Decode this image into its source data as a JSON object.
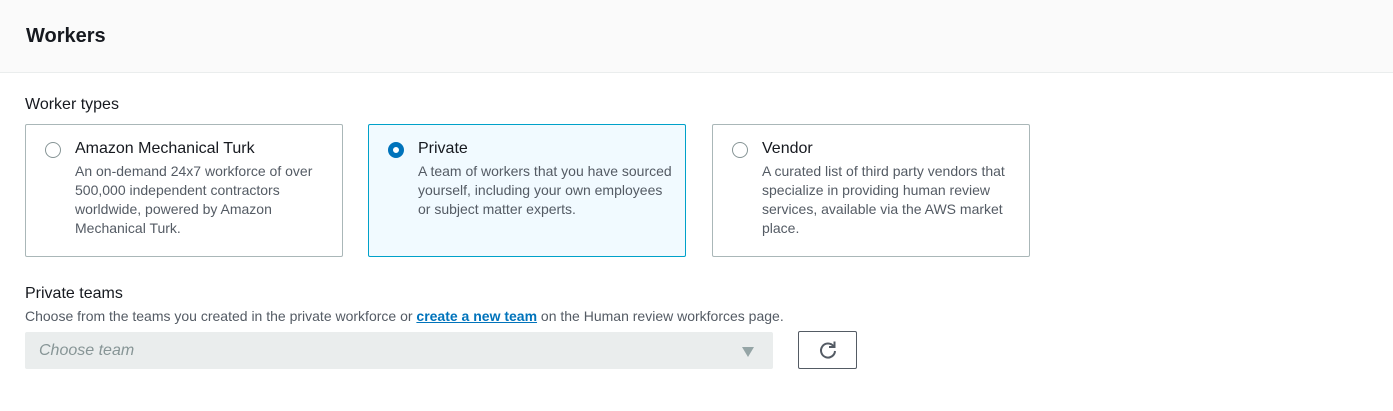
{
  "header": {
    "title": "Workers"
  },
  "worker_types": {
    "label": "Worker types",
    "options": [
      {
        "title": "Amazon Mechanical Turk",
        "description": "An on-demand 24x7 workforce of over 500,000 independent contractors worldwide, powered by Amazon Mechanical Turk.",
        "selected": false
      },
      {
        "title": "Private",
        "description": "A team of workers that you have sourced yourself, including your own employees or subject matter experts.",
        "selected": true
      },
      {
        "title": "Vendor",
        "description": "A curated list of third party vendors that specialize in providing human review services, available via the AWS market place.",
        "selected": false
      }
    ]
  },
  "private_teams": {
    "label": "Private teams",
    "description_before": "Choose from the teams you created in the private workforce or ",
    "link_text": "create a new team",
    "description_after": " on the Human review workforces page.",
    "select_placeholder": "Choose team",
    "refresh_icon": "refresh-icon"
  },
  "colors": {
    "accent": "#0073bb",
    "selected_border": "#00a1c9",
    "selected_background": "#f1faff"
  }
}
